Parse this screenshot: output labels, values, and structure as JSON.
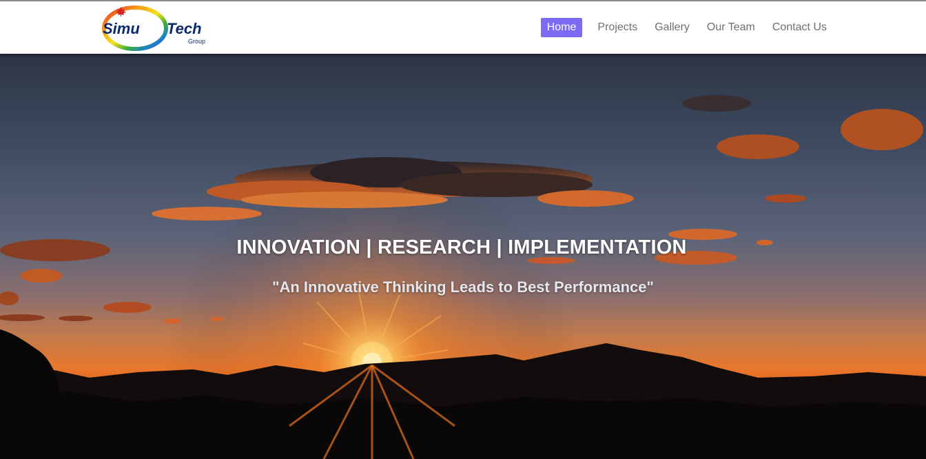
{
  "brand": {
    "logo_text_left": "Simu",
    "logo_text_right": "Tech",
    "logo_subtext": "Group",
    "colors": {
      "navy": "#0b2a6b",
      "ring_red": "#e8262a",
      "ring_orange": "#f6a11b",
      "ring_green": "#3fae3a",
      "ring_blue": "#1b7fd0",
      "ring_violet": "#6a3aa0"
    }
  },
  "nav": {
    "items": [
      {
        "label": "Home",
        "active": true
      },
      {
        "label": "Projects",
        "active": false
      },
      {
        "label": "Gallery",
        "active": false
      },
      {
        "label": "Our Team",
        "active": false
      },
      {
        "label": "Contact Us",
        "active": false
      }
    ],
    "active_color": "#7b6cf6",
    "text_color": "#6f6f6f"
  },
  "hero": {
    "title": "INNOVATION | RESEARCH | IMPLEMENTATION",
    "subtitle": "\"An Innovative Thinking Leads to Best Performance\"",
    "background_image": "sunset-over-mountains"
  }
}
